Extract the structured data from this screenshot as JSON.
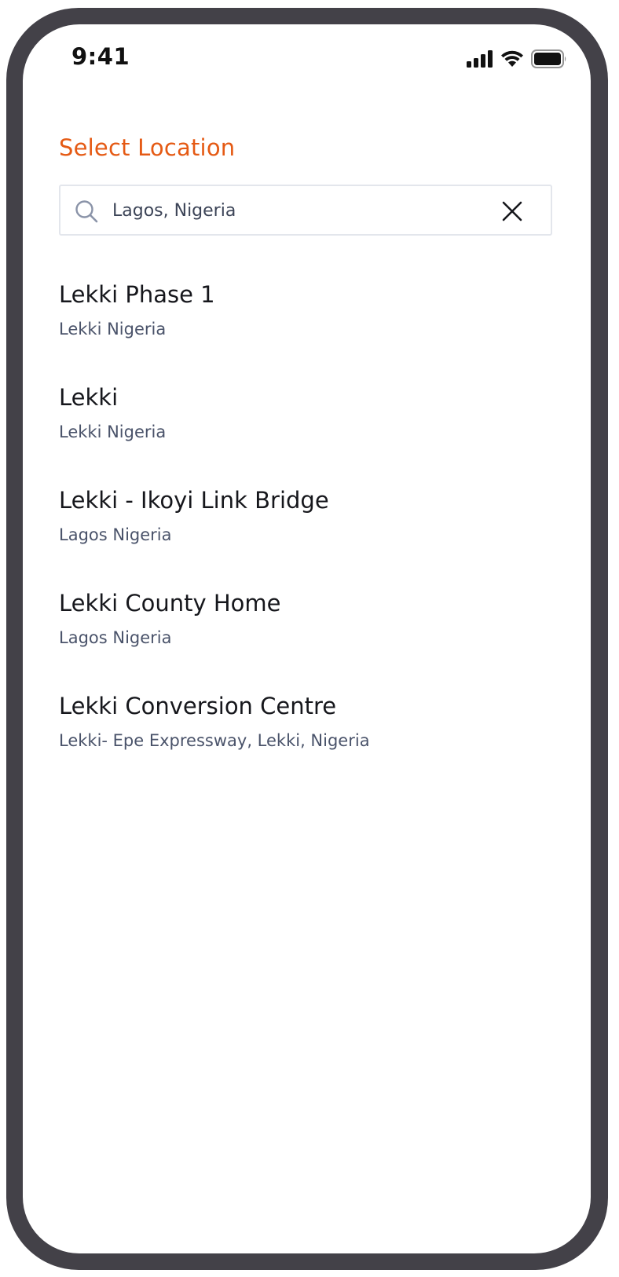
{
  "status_bar": {
    "time": "9:41",
    "icons": [
      "cellular-signal-icon",
      "wifi-icon",
      "battery-icon"
    ]
  },
  "header": {
    "title": "Select Location"
  },
  "search": {
    "value": "Lagos, Nigeria",
    "icon": "search-icon",
    "clear_icon": "close-icon"
  },
  "results": [
    {
      "title": "Lekki Phase 1",
      "subtitle": "Lekki Nigeria"
    },
    {
      "title": "Lekki",
      "subtitle": "Lekki Nigeria"
    },
    {
      "title": "Lekki - Ikoyi Link Bridge",
      "subtitle": "Lagos Nigeria"
    },
    {
      "title": "Lekki County Home",
      "subtitle": "Lagos Nigeria"
    },
    {
      "title": "Lekki Conversion Centre",
      "subtitle": "Lekki- Epe Expressway, Lekki, Nigeria"
    }
  ],
  "colors": {
    "accent": "#e55a14",
    "device_frame": "#434148",
    "title_text": "#16171c",
    "subtitle_text": "#4a536a",
    "search_border": "#e3e6ec"
  }
}
